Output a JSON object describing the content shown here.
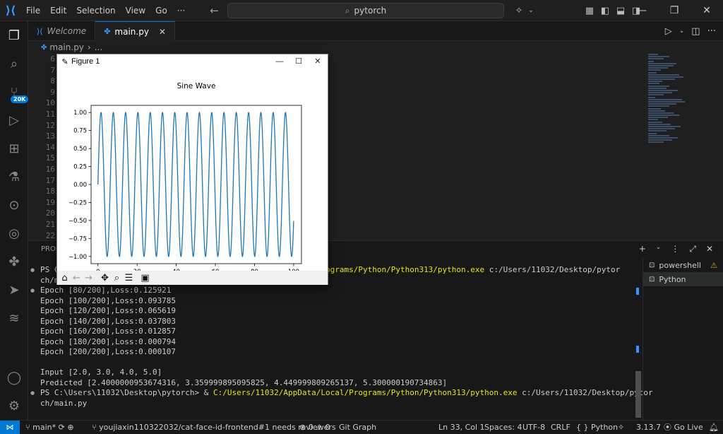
{
  "titlebar": {
    "menu": [
      "File",
      "Edit",
      "Selection",
      "View",
      "Go",
      "···"
    ],
    "search_text": "pytorch",
    "icons": [
      "back-arrow-icon",
      "forward-arrow-icon",
      "copilot-icon",
      "layout-icons",
      "minimize-icon",
      "restore-icon",
      "close-icon"
    ]
  },
  "activitybar": {
    "icons": [
      "explorer-icon",
      "search-icon",
      "source-control-icon",
      "run-debug-icon",
      "extensions-icon",
      "testing-icon",
      "git-graph-icon",
      "docker-icon",
      "figma-icon",
      "deploy-icon",
      "layers-icon"
    ],
    "scm_badge": "20K",
    "bottom_icons": [
      "account-icon",
      "settings-icon"
    ]
  },
  "tabs": [
    {
      "label": "Welcome",
      "active": false
    },
    {
      "label": "main.py",
      "active": true
    }
  ],
  "breadcrumb": {
    "file": "main.py",
    "more": "..."
  },
  "editor": {
    "line_numbers": [
      "6",
      "7",
      "8",
      "9",
      "10",
      "11",
      "12",
      "13",
      "14",
      "15",
      "16",
      "17",
      "18",
      "19",
      "20",
      "21",
      "22"
    ]
  },
  "panel": {
    "tab_label": "PROB",
    "terminal_lines": [
      {
        "text": "PS C",
        "gap": "                                                     ",
        "rest": "l/Programs/Python/Python313/python.exe",
        "tail": " c:/Users/11032/Desktop/pytor"
      },
      {
        "text": "ch/ma"
      },
      {
        "text": "Epoch [80/200],Loss:0.125921"
      },
      {
        "text": "Epoch [100/200],Loss:0.093785"
      },
      {
        "text": "Epoch [120/200],Loss:0.065619"
      },
      {
        "text": "Epoch [140/200],Loss:0.037803"
      },
      {
        "text": "Epoch [160/200],Loss:0.012857"
      },
      {
        "text": "Epoch [180/200],Loss:0.000794"
      },
      {
        "text": "Epoch [200/200],Loss:0.000107"
      },
      {
        "text": ""
      },
      {
        "text": "Input [2.0, 3.0, 4.0, 5.0]"
      },
      {
        "text": "Predicted [2.4000000953674316, 3.359999895095825, 4.449999809265137, 5.300000190734863]"
      },
      {
        "text": "PS C:\\Users\\11032\\Desktop\\pytorch> & ",
        "rest": "C:/Users/11032/AppData/Local/Programs/Python/Python313/python.exe",
        "tail": " c:/Users/11032/Desktop/pytor"
      },
      {
        "text": "ch/main.py"
      }
    ],
    "terminals": [
      {
        "label": "powershell",
        "warning": true
      },
      {
        "label": "Python",
        "warning": false
      }
    ]
  },
  "statusbar": {
    "branch": "main*",
    "pr": "youjiaxin110322032/cat-face-id-frontend#1 needs reviewers",
    "problems": "⊗ 0 ⚠ 0",
    "git_graph": "Git Graph",
    "position": "Ln 33, Col 1",
    "spaces": "Spaces: 4",
    "encoding": "UTF-8",
    "eol": "CRLF",
    "language": "{ } Python",
    "python_version": "3.13.7",
    "go_live": "Go Live"
  },
  "figure": {
    "window_title": "Figure 1",
    "toolbar_icons": [
      "home-icon",
      "back-icon",
      "forward-icon",
      "pan-icon",
      "zoom-icon",
      "configure-icon",
      "save-icon"
    ]
  },
  "chart_data": {
    "type": "line",
    "title": "Sine Wave",
    "xlabel": "",
    "ylabel": "",
    "x_range": [
      0,
      100
    ],
    "xlim": [
      -3.5,
      104
    ],
    "ylim": [
      -1.1,
      1.1
    ],
    "xticks": [
      0,
      20,
      40,
      60,
      80,
      100
    ],
    "yticks": [
      -1.0,
      -0.75,
      -0.5,
      -0.25,
      0.0,
      0.25,
      0.5,
      0.75,
      1.0
    ],
    "ytick_labels": [
      "−1.00",
      "−0.75",
      "−0.50",
      "−0.25",
      "0.00",
      "0.25",
      "0.50",
      "0.75",
      "1.00"
    ],
    "function": "y = sin(x)",
    "series_color": "#1f77b4",
    "grid": false
  }
}
